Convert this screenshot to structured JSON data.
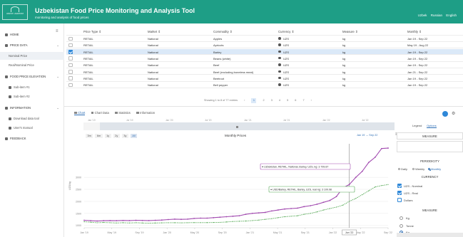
{
  "header": {
    "logo_text": "UZSTAT / AGRISTAT",
    "title": "Uzbekistan Food Price Monitoring and Analysis Tool",
    "subtitle": "monitoring and analysis of food prices",
    "languages": [
      "Uzbek",
      "Russian",
      "English"
    ]
  },
  "sidebar": {
    "items": [
      {
        "label": "HOME",
        "icon": "home-icon"
      },
      {
        "label": "PRICE DATA",
        "icon": "table-icon",
        "chevron": "v"
      },
      {
        "label": "Nominal Price",
        "sub": true,
        "active": true
      },
      {
        "label": "Real/Nominal Price",
        "sub": true
      },
      {
        "label": "FOOD PRICE ELEVATION",
        "icon": "chart-icon",
        "chevron": "v"
      },
      {
        "label": "Sub-item #1",
        "icon": "bar-icon",
        "sub": true
      },
      {
        "label": "Sub-item #2",
        "icon": "bar-icon",
        "sub": true
      },
      {
        "label": "INFORMATION",
        "icon": "info-icon",
        "chevron": "v"
      },
      {
        "label": "Download data tool",
        "icon": "download-icon",
        "sub": true
      },
      {
        "label": "User's manual",
        "icon": "manual-icon",
        "sub": true
      },
      {
        "label": "FEEDBACK",
        "icon": "feedback-icon"
      }
    ]
  },
  "table": {
    "columns": [
      "Price Type",
      "Market",
      "Commodity",
      "Currency",
      "Measure",
      "Monthly"
    ],
    "rows": [
      {
        "price_type": "RETAIL",
        "market": "National",
        "commodity": "Apples",
        "currency": "UZS",
        "measure": "kg",
        "range": "Jan 19 - Sep 22",
        "checked": false
      },
      {
        "price_type": "RETAIL",
        "market": "National",
        "commodity": "Apricots",
        "currency": "UZS",
        "measure": "kg",
        "range": "May 19 - Aug 22",
        "checked": false
      },
      {
        "price_type": "RETAIL",
        "market": "National",
        "commodity": "Barley",
        "currency": "UZS",
        "measure": "kg",
        "range": "Jan 19 - Sep 22",
        "checked": true
      },
      {
        "price_type": "RETAIL",
        "market": "National",
        "commodity": "Beans (white)",
        "currency": "UZS",
        "measure": "kg",
        "range": "Jan 19 - Sep 22",
        "checked": false
      },
      {
        "price_type": "RETAIL",
        "market": "National",
        "commodity": "Beef",
        "currency": "UZS",
        "measure": "kg",
        "range": "Jan 19 - Sep 22",
        "checked": false
      },
      {
        "price_type": "RETAIL",
        "market": "National",
        "commodity": "Beef (excluding boneless meat)",
        "currency": "UZS",
        "measure": "kg",
        "range": "Jan 21 - Sep 22",
        "checked": false
      },
      {
        "price_type": "RETAIL",
        "market": "National",
        "commodity": "Beetroot",
        "currency": "UZS",
        "measure": "kg",
        "range": "Jan 19 - Sep 22",
        "checked": false
      },
      {
        "price_type": "RETAIL",
        "market": "National",
        "commodity": "Bell pepper",
        "currency": "UZS",
        "measure": "kg",
        "range": "Jan 19 - Sep 22",
        "checked": false
      }
    ],
    "pager_text": "Showing 1 to 8 of 77 entries",
    "pages": [
      "1",
      "2",
      "3",
      "4",
      "5",
      "6",
      "7"
    ],
    "current_page": "1"
  },
  "chart_tabs": [
    "Chart",
    "Chart Data",
    "Statistics",
    "Information"
  ],
  "chart_panel": {
    "zoom_buttons": [
      "3m",
      "6m",
      "1y",
      "2y",
      "3y",
      "All"
    ],
    "zoom_selected": "All",
    "navigator_ticks": [
      "Jan '19",
      "Jul '19",
      "Jan '20",
      "Jul '20",
      "Jan '21",
      "Jul '21",
      "Jan '22",
      "Jul '22"
    ],
    "range_text": "Jan 19 → Sep 22",
    "tooltip_nominal": "● Uzbekistan, RETAIL, National, Barley, UZS, kg: 3 799.87",
    "tooltip_real": "● USD/Barley, RETAIL, Barley, UZS, real kg: 3 109.98"
  },
  "chart_data": {
    "type": "line",
    "title": "Monthly Prices",
    "ylabel": "UZS/kg",
    "x_ticks": [
      "Jan '19",
      "May '19",
      "Sep '19",
      "Jan '20",
      "May '20",
      "Sep '20",
      "Jan '21",
      "May '21",
      "Sep '21",
      "Jan '22",
      "May '22",
      "Sep '22"
    ],
    "y_ticks": [
      1000,
      1500,
      2000,
      2500,
      3000
    ],
    "ylim": [
      900,
      4400
    ],
    "x_index_range": [
      0,
      44
    ],
    "hover_label": "Jun '22",
    "hover_index": 41,
    "grid": true,
    "series": [
      {
        "name": "UZS - Nominal",
        "color": "#a24bb0",
        "values": [
          1210,
          1195,
          1180,
          1195,
          1200,
          1195,
          1205,
          1200,
          1210,
          1205,
          1200,
          1210,
          1220,
          1240,
          1260,
          1250,
          1260,
          1290,
          1300,
          1300,
          1320,
          1340,
          1360,
          1380,
          1400,
          1460,
          1500,
          1520,
          1540,
          1600,
          1640,
          1680,
          1700,
          1720,
          1780,
          1820,
          1880,
          1960,
          2040,
          2200,
          2560,
          2700,
          3000,
          3250,
          3620,
          3840,
          4200,
          4220
        ]
      },
      {
        "name": "UZS - Real",
        "color": "#54a854",
        "values": [
          1150,
          1130,
          1110,
          1120,
          1110,
          1100,
          1110,
          1100,
          1110,
          1100,
          1090,
          1100,
          1105,
          1110,
          1110,
          1105,
          1110,
          1115,
          1115,
          1115,
          1120,
          1125,
          1140,
          1160,
          1170,
          1180,
          1200,
          1220,
          1250,
          1280,
          1320,
          1360,
          1380,
          1400,
          1460,
          1500,
          1560,
          1640,
          1700,
          1760,
          1840,
          2000,
          2120,
          2280,
          2440,
          2600,
          2660,
          2700
        ]
      }
    ]
  },
  "right_panel": {
    "legend_label": "Legend",
    "options_label": "Options",
    "measure_header": "MEASURE",
    "periodicity_label": "PERIODICITY",
    "periodicity_options": [
      "Daily",
      "Weekly",
      "Monthly"
    ],
    "periodicity_selected": "Monthly",
    "currency_header": "CURRENCY",
    "currency_options": [
      {
        "label": "UZS - Nominal",
        "checked": true
      },
      {
        "label": "UZS - Real",
        "checked": true
      },
      {
        "label": "Dollars",
        "checked": false
      }
    ],
    "measure2_header": "MEASURE",
    "measure_options": [
      "Kg",
      "Tonne",
      "Kg"
    ],
    "measure_selected_index": 2
  }
}
